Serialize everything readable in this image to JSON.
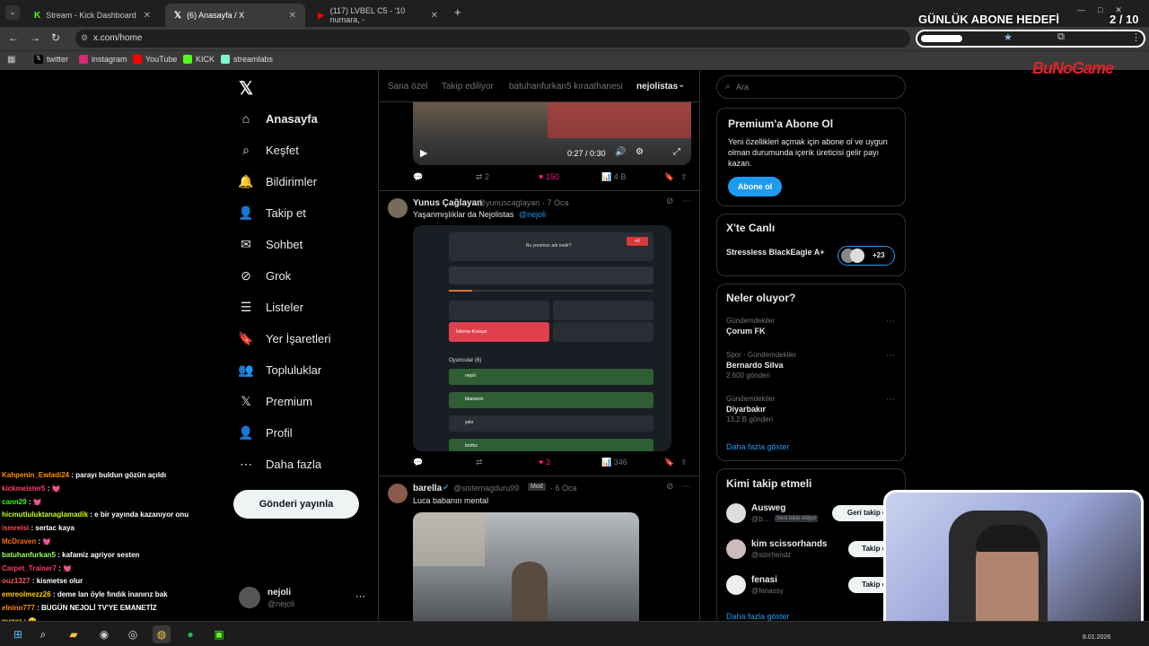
{
  "browser": {
    "tabs": [
      {
        "label": "Stream - Kick Dashboard",
        "icon": "kick-icon"
      },
      {
        "label": "(6) Anasayfa / X",
        "icon": "x-icon"
      },
      {
        "label": "(117) LVBEL C5 - '10 numara, -",
        "icon": "youtube-icon"
      }
    ],
    "new_tab": "+",
    "url": "x.com/home",
    "bookmarks": [
      {
        "label": "twitter",
        "color": "#000000"
      },
      {
        "label": "instagram",
        "color": "#d62976"
      },
      {
        "label": "YouTube",
        "color": "#ff0000"
      },
      {
        "label": "KICK",
        "color": "#53fc18"
      },
      {
        "label": "streamlabs",
        "color": "#80f5d2"
      }
    ]
  },
  "overlay": {
    "goal_label": "GÜNLÜK ABONE HEDEFİ",
    "goal_value": "2 / 10",
    "logo": "BuNoGame"
  },
  "nav": {
    "items": [
      {
        "label": "Anasayfa",
        "icon": "home-icon",
        "glyph": "⌂"
      },
      {
        "label": "Keşfet",
        "icon": "search-icon",
        "glyph": "⌕"
      },
      {
        "label": "Bildirimler",
        "icon": "bell-icon",
        "glyph": "🔔"
      },
      {
        "label": "Takip et",
        "icon": "follow-icon",
        "glyph": "👤"
      },
      {
        "label": "Sohbet",
        "icon": "mail-icon",
        "glyph": "✉"
      },
      {
        "label": "Grok",
        "icon": "grok-icon",
        "glyph": "⊘"
      },
      {
        "label": "Listeler",
        "icon": "list-icon",
        "glyph": "☰"
      },
      {
        "label": "Yer İşaretleri",
        "icon": "bookmark-icon",
        "glyph": "🔖"
      },
      {
        "label": "Topluluklar",
        "icon": "communities-icon",
        "glyph": "👥"
      },
      {
        "label": "Premium",
        "icon": "x-icon",
        "glyph": "𝕏"
      },
      {
        "label": "Profil",
        "icon": "profile-icon",
        "glyph": "👤"
      },
      {
        "label": "Daha fazla",
        "icon": "more-icon",
        "glyph": "⋯"
      }
    ],
    "post_button": "Gönderi yayınla",
    "account": {
      "name": "nejoli",
      "handle": "@nejoli"
    }
  },
  "feed": {
    "tabs": [
      "Sana özel",
      "Takip ediliyor",
      "batuhanfurkan5 kıraathanesi",
      "nejolistas"
    ],
    "video": {
      "time": "0:27 / 0:30"
    },
    "tweet0_actions": {
      "retweets": "2",
      "likes": "150",
      "views": "4 B"
    },
    "tweet1": {
      "name": "Yunus Çağlayan",
      "handle": "@yunuscaglayan",
      "date": "· 7 Oca",
      "text": "Yaşanmışlıklar da Nejolistas",
      "mention": "@nejoli",
      "quiz_question": "Bu yorumun adı nedir?",
      "quiz_badge": "+6",
      "answer_selected": "İskerse-Kovsun",
      "players_label": "Oyuncular (6)",
      "players": [
        "nejoli",
        "bbaranck",
        "yolo",
        "brofoz"
      ],
      "likes": "3",
      "views": "346"
    },
    "tweet2": {
      "name": "barella",
      "handle": "@sistemagduru99",
      "badge": "Mod",
      "date": "· 6 Oca",
      "text": "Luca babanın mental"
    }
  },
  "right": {
    "search_placeholder": "Ara",
    "premium": {
      "title": "Premium'a Abone Ol",
      "text": "Yeni özellikleri açmak için abone ol ve uygun olman durumunda içerik üreticisi gelir payı kazan.",
      "button": "Abone ol"
    },
    "live": {
      "title": "X'te Canlı",
      "item": "Stressless BlackEagle A+",
      "count": "+23"
    },
    "trends": {
      "title": "Neler oluyor?",
      "items": [
        {
          "category": "Gündemdekiler",
          "name": "Çorum FK",
          "count": ""
        },
        {
          "category": "Spor · Gündemdekiler",
          "name": "Bernardo Silva",
          "count": "2.600 gönderi"
        },
        {
          "category": "Gündemdekiler",
          "name": "Diyarbakır",
          "count": "13,2 B gönderi"
        }
      ],
      "more": "Daha fazla göster"
    },
    "follow": {
      "title": "Kimi takip etmeli",
      "items": [
        {
          "name": "Ausweg",
          "handle": "@b...",
          "badge": "Seni takip ediyor",
          "button": "Geri takip et"
        },
        {
          "name": "kim scissorhands",
          "handle": "@sizirhendz",
          "badge": "",
          "button": "Takip et"
        },
        {
          "name": "fenasi",
          "handle": "@fenassy",
          "badge": "",
          "button": "Takip et"
        }
      ],
      "more": "Daha fazla göster"
    }
  },
  "chat": [
    {
      "user": "Kahpenin_Ewladi24",
      "msg": ": parayı buldun gözün açıldı",
      "color": "#ff8c00"
    },
    {
      "user": "kickmeister5",
      "msg": ": 💓",
      "color": "#ff3b6b"
    },
    {
      "user": "cann29",
      "msg": ": 💓",
      "color": "#39ff14"
    },
    {
      "user": "hicmutluluktanaglamadik",
      "msg": ": e bir yayında kazanıyor onu",
      "color": "#c6ff00"
    },
    {
      "user": "ismreisi",
      "msg": ": sertac kaya",
      "color": "#ff4d4d"
    },
    {
      "user": "McDraven",
      "msg": ": 💓",
      "color": "#ff6a00"
    },
    {
      "user": "batuhanfurkan5",
      "msg": ": kafamiz agriyor sesten",
      "color": "#9bff5b"
    },
    {
      "user": "Carpet_Trainer7",
      "msg": ": 💓",
      "color": "#ff3b6b"
    },
    {
      "user": "ouz1327",
      "msg": ": kismetse olur",
      "color": "#ff5757"
    },
    {
      "user": "emreolmezz26",
      "msg": ": deme lan öyle fındık inanırız bak",
      "color": "#ffd000"
    },
    {
      "user": "elnino777",
      "msg": ": BUGÜN NEJOLİ TV'YE EMANETİZ",
      "color": "#ff8c00"
    },
    {
      "user": "pugar",
      "msg": ": 🙂",
      "color": "#ffd000"
    }
  ],
  "taskbar": {
    "date": "8.01.2026"
  }
}
